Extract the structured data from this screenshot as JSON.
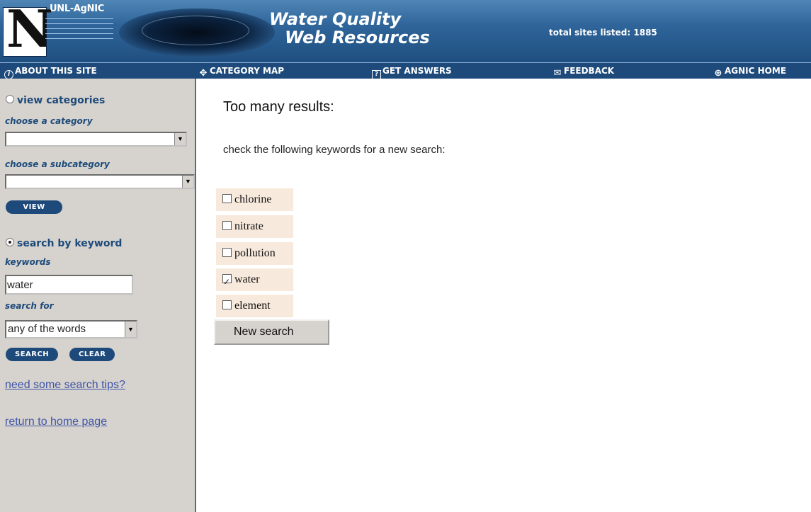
{
  "banner": {
    "brand": "UNL-AgNIC",
    "logo_letter": "N",
    "title_line1": "Water Quality",
    "title_line2": "Web Resources",
    "total_sites": "total sites listed: 1885"
  },
  "nav": {
    "items": [
      {
        "icon": "info-icon",
        "label": "ABOUT THIS SITE"
      },
      {
        "icon": "arrows-icon",
        "label": "CATEGORY MAP"
      },
      {
        "icon": "question-icon",
        "label": "GET ANSWERS"
      },
      {
        "icon": "mail-icon",
        "label": "FEEDBACK"
      },
      {
        "icon": "globe-icon",
        "label": "AGNIC HOME"
      }
    ]
  },
  "sidebar": {
    "view_categories_label": "view categories",
    "view_categories_selected": false,
    "choose_category_label": "choose a category",
    "category_value": "",
    "choose_subcategory_label": "choose a subcategory",
    "subcategory_value": "",
    "view_button": "VIEW",
    "search_keyword_label": "search by keyword",
    "search_keyword_selected": true,
    "keywords_label": "keywords",
    "keywords_value": "water",
    "search_for_label": "search for",
    "search_for_value": "any of the words",
    "search_button": "SEARCH",
    "clear_button": "CLEAR",
    "tips_link": "need some search tips?",
    "home_link": "return to home page"
  },
  "main": {
    "heading": "Too many results:",
    "instructions": "check the following keywords for a new search:",
    "keywords": [
      {
        "label": "chlorine",
        "checked": false
      },
      {
        "label": "nitrate",
        "checked": false
      },
      {
        "label": "pollution",
        "checked": false
      },
      {
        "label": "water",
        "checked": true
      },
      {
        "label": "element",
        "checked": false
      }
    ],
    "new_search_button": "New search"
  },
  "colors": {
    "banner": "#2f659a",
    "navbar": "#1d4a7a",
    "sidebar": "#d6d3ce",
    "keyword_row": "#f7e9dc",
    "link": "#3f54a8"
  }
}
